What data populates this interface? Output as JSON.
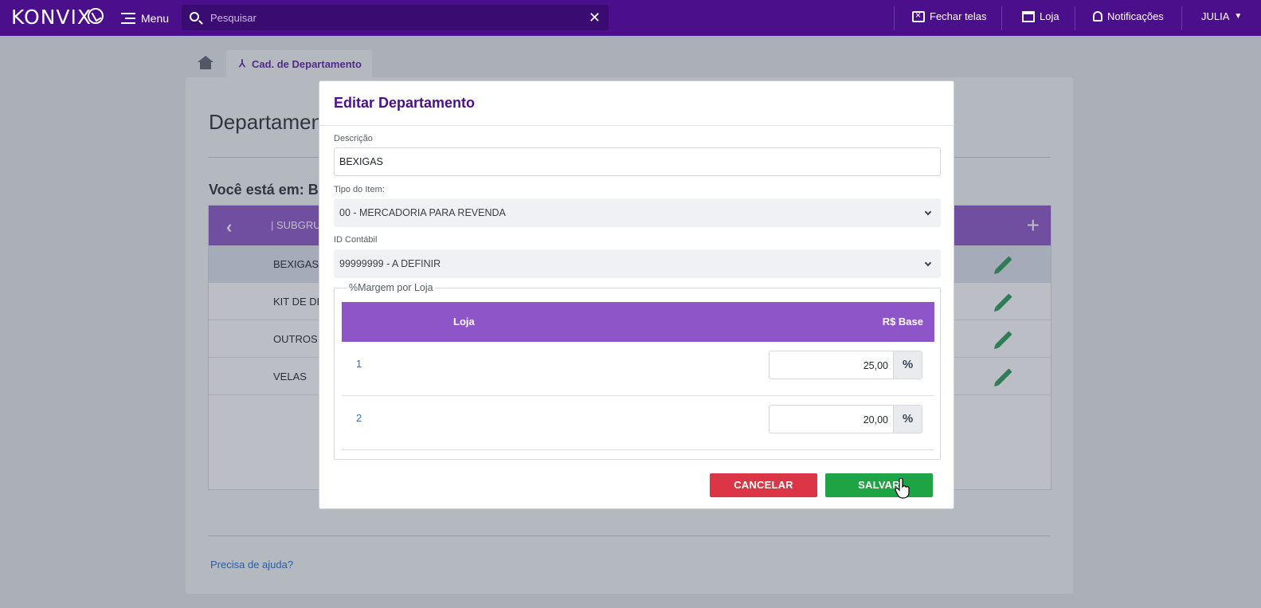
{
  "topbar": {
    "logo": "KONVIX",
    "menu_label": "Menu",
    "search_placeholder": "Pesquisar",
    "close_screens": "Fechar telas",
    "store": "Loja",
    "notifications": "Notificações",
    "user": "JULIA"
  },
  "page": {
    "tab_label": "Cad. de Departamento",
    "title": "Departament",
    "breadcrumb": "Você está em: BA",
    "grid_header": "| SUBGRU",
    "rows": [
      "BEXIGAS",
      "KIT DE DEC",
      "OUTROS",
      "VELAS"
    ],
    "help_link": "Precisa de ajuda?"
  },
  "modal": {
    "title": "Editar Departamento",
    "descricao_label": "Descrição",
    "descricao_value": "BEXIGAS",
    "tipo_label": "Tipo do Item:",
    "tipo_value": "00 - MERCADORIA PARA REVENDA",
    "id_label": "ID Contábil",
    "id_value": "99999999 - A DEFINIR",
    "margem_legend": "%Margem por Loja",
    "col_loja": "Loja",
    "col_base": "R$ Base",
    "lojas": [
      {
        "loja": "1",
        "valor": "25,00",
        "unit": "%"
      },
      {
        "loja": "2",
        "valor": "20,00",
        "unit": "%"
      }
    ],
    "cancel": "CANCELAR",
    "save": "SALVAR"
  },
  "colors": {
    "primary": "#4b0f8c",
    "header": "#8e55c8",
    "cancel": "#dc3545",
    "save": "#1fa445"
  }
}
